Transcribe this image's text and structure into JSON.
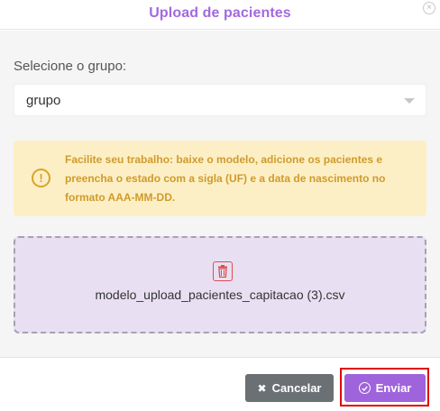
{
  "modal": {
    "title": "Upload de pacientes",
    "close_icon": "close-circle-icon"
  },
  "form": {
    "group_label": "Selecione o grupo:",
    "group_select_value": "grupo"
  },
  "warning": {
    "icon": "exclamation-circle-icon",
    "text": "Facilite seu trabalho: baixe o modelo, adicione os pacientes e preencha o estado com a sigla (UF) e a data de nascimento no formato AAA-MM-DD."
  },
  "upload": {
    "file_name": "modelo_upload_pacientes_capitacao (3).csv",
    "remove_icon": "trash-icon"
  },
  "footer": {
    "cancel_label": "Cancelar",
    "send_label": "Enviar"
  },
  "colors": {
    "accent": "#a269e0",
    "send_button": "#9f63db",
    "cancel_button": "#6b7075",
    "warning_bg": "#fdefc5",
    "warning_text": "#cf9b2c",
    "dropzone_bg": "#e8e0f2",
    "highlight": "#e00000"
  }
}
